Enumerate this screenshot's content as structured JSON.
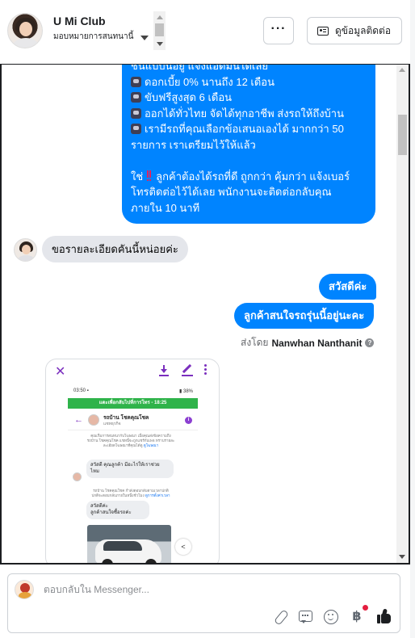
{
  "header": {
    "page_name": "U Mi Club",
    "assign_label": "มอบหมายการสนทนานี้",
    "more_label": "···",
    "contact_label": "ดูข้อมูลติดต่อ"
  },
  "conversation": {
    "big_message": {
      "line0": "ชันแบบนีอยู่ แจ้งแอดมินได้เลย",
      "line1": "ดอกเบี้ย 0% นานถึง 12 เดือน",
      "line2": "ขับฟรีสูงสุด 6 เดือน",
      "line3": "ออกได้ทั่วไทย จัดได้ทุกอาชีพ ส่งรถให้ถึงบ้าน",
      "line4": "เรามีรถที่คุณเลือกข้อเสนอเองได้ มากกว่า 50",
      "line5": "รายการ เราเตรียมไว้ให้แล้ว",
      "line6a": "ใช่",
      "line6b": "ลูกค้าต้องได้รถที่ดี ถูกกว่า คุ้มกว่า แจ้งเบอร์",
      "line7": "โทรติดต่อไว้ได้เลย พนักงานจะติดต่อกลับคุณ",
      "line8": "ภายใน 10 นาที"
    },
    "customer_message": "ขอรายละเอียดคันนี้หน่อยค่ะ",
    "reply_hello": "สวัสดีค่ะ",
    "reply_interest": "ลูกค้าสนใจรถรุ่นนี้อยู่นะคะ",
    "sent_by_prefix": "ส่งโดย",
    "sent_by_name": "Nanwhan Nanthanit",
    "sent_by_info": "?"
  },
  "screenshot": {
    "close": "✕",
    "time": "03:50 ▪",
    "status_right": "▮ 38%",
    "green_bar": "แตะเพื่อกลับไปที่การโทร - 18:25",
    "contact_name": "รถบ้าน โชคคุณโชค",
    "contact_sub": "แชทธุรกิจ",
    "info": "i",
    "back": "←",
    "note1_a": "คุณเริ่มการสนทนากับโฆษณา เมื่อคุณส่งข้อความถึง",
    "note1_b": "รถบ้าน โชคคุณโชค แชทนี้จะถูกแชร์กับเพจ ทราบรายละ",
    "note1_c": "ละเอียดโฆษณาที่คุณได้ดู",
    "note1_link": "ดูโฆษณา",
    "bubble1_a": "สวัสดี คุณลูกค้า มีอะไรให้เราช่วย",
    "bubble1_b": "ไหม",
    "note2_a": "รถบ้าน โชคคุณโชค กำลังตอบกลับตามเวลาปกติ",
    "note2_b": "ปกติจะตอบกลับภายในหนึ่งชั่วโมง",
    "note2_link": "ดูการตั้งค่าเวลา",
    "bubble2_a": "สวัสดีค่ะ",
    "bubble2_b": "ลูกค้าสนใจซื้อรถค่ะ",
    "share": "<"
  },
  "composer": {
    "placeholder": "ตอบกลับใน Messenger...",
    "baht": "฿"
  }
}
